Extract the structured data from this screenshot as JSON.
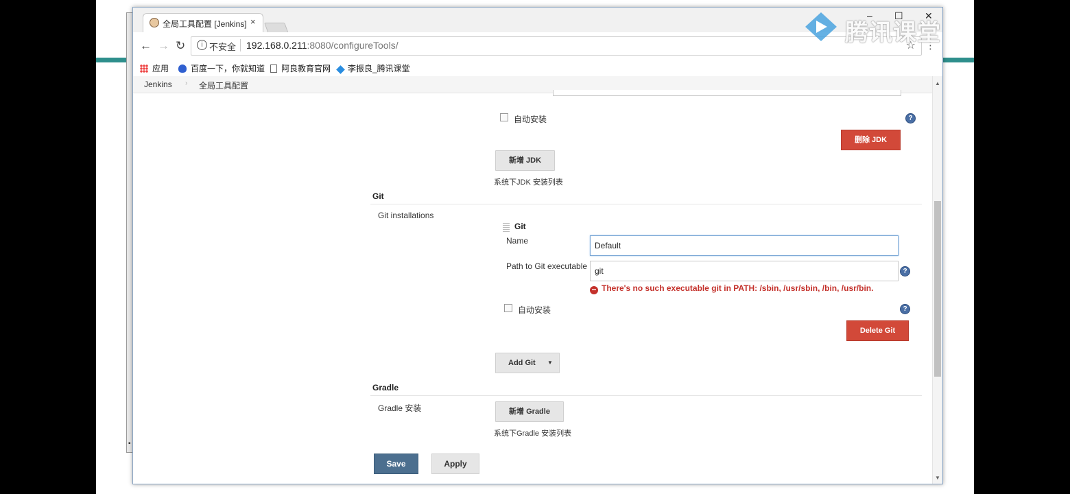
{
  "browser": {
    "tab_title": "全局工具配置 [Jenkins]",
    "tab_close": "×",
    "security_label": "不安全",
    "url_host": "192.168.0.211",
    "url_rest": ":8080/configureTools/",
    "window_controls": {
      "minimize": "–",
      "maximize": "☐",
      "close": "✕"
    }
  },
  "bookmarks": [
    {
      "label": "应用",
      "icon": "apps-grid-icon"
    },
    {
      "label": "百度一下，你就知道",
      "icon": "baidu-paw-icon"
    },
    {
      "label": "阿良教育官网",
      "icon": "page-icon"
    },
    {
      "label": "李振良_腾讯课堂",
      "icon": "tencent-class-icon"
    }
  ],
  "breadcrumb": {
    "root": "Jenkins",
    "current": "全局工具配置"
  },
  "jdk": {
    "auto_install_label": "自动安装",
    "delete_button": "删除 JDK",
    "add_button": "新增 JDK",
    "list_caption": "系统下JDK 安装列表"
  },
  "git": {
    "section_title": "Git",
    "installations_label": "Git installations",
    "entry_title": "Git",
    "name_label": "Name",
    "name_value": "Default",
    "path_label": "Path to Git executable",
    "path_value": "git",
    "error_text": "There's no such executable git in PATH: /sbin, /usr/sbin, /bin, /usr/bin.",
    "auto_install_label": "自动安装",
    "delete_button": "Delete Git",
    "add_button": "Add Git"
  },
  "gradle": {
    "section_title": "Gradle",
    "install_label": "Gradle 安装",
    "add_button": "新增 Gradle",
    "list_caption": "系统下Gradle 安装列表"
  },
  "actions": {
    "save": "Save",
    "apply": "Apply"
  },
  "watermark": {
    "text": "腾讯课堂"
  },
  "colors": {
    "accent_teal": "#2e8f8c",
    "danger": "#d24939",
    "save_blue": "#4c6f8f",
    "error_red": "#c4312b"
  }
}
